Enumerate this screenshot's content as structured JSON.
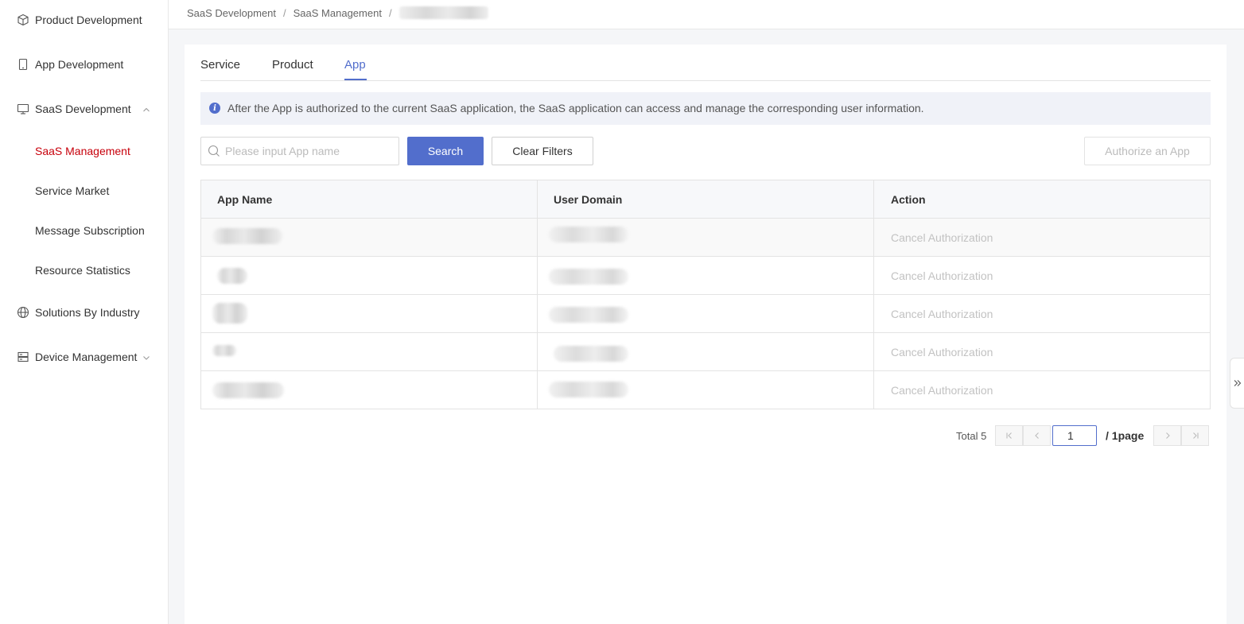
{
  "sidebar": {
    "items": [
      {
        "label": "Product Development",
        "icon": "cube-icon"
      },
      {
        "label": "App Development",
        "icon": "phone-icon"
      },
      {
        "label": "SaaS Development",
        "icon": "monitor-icon",
        "expanded": true
      },
      {
        "label": "Solutions By Industry",
        "icon": "globe-icon"
      },
      {
        "label": "Device Management",
        "icon": "server-icon",
        "expanded": false
      }
    ],
    "subitems": [
      {
        "label": "SaaS Management",
        "active": true
      },
      {
        "label": "Service Market"
      },
      {
        "label": "Message Subscription"
      },
      {
        "label": "Resource Statistics"
      }
    ]
  },
  "breadcrumb": {
    "items": [
      "SaaS Development",
      "SaaS Management"
    ],
    "separator": "/"
  },
  "tabs": [
    {
      "label": "Service"
    },
    {
      "label": "Product"
    },
    {
      "label": "App",
      "active": true
    }
  ],
  "notice": {
    "icon": "info-icon",
    "text": "After the App is authorized to the current SaaS application, the SaaS application can access and manage the corresponding user information."
  },
  "filters": {
    "search_placeholder": "Please input App name",
    "search_value": "",
    "search_button": "Search",
    "clear_button": "Clear Filters",
    "authorize_button": "Authorize an App"
  },
  "table": {
    "columns": [
      "App Name",
      "User Domain",
      "Action"
    ],
    "rows": [
      {
        "action": "Cancel Authorization"
      },
      {
        "action": "Cancel Authorization"
      },
      {
        "action": "Cancel Authorization"
      },
      {
        "action": "Cancel Authorization"
      },
      {
        "action": "Cancel Authorization"
      }
    ]
  },
  "pagination": {
    "total_label": "Total 5",
    "current_page": "1",
    "page_count_label": "/ 1page"
  },
  "colors": {
    "accent": "#526ecc",
    "active_nav": "#c7000b",
    "disabled_text": "#c2c2c2"
  }
}
